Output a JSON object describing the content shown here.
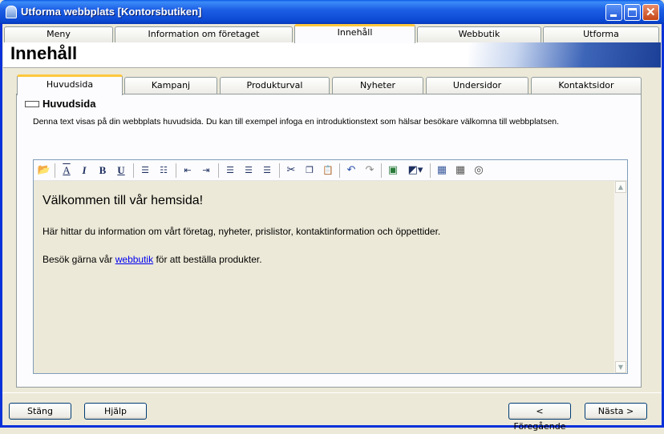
{
  "window": {
    "title": "Utforma webbplats [Kontorsbutiken]"
  },
  "top_tabs": [
    "Meny",
    "Information om företaget",
    "Innehåll",
    "Webbutik",
    "Utforma"
  ],
  "header": {
    "title": "Innehåll"
  },
  "inner_tabs": [
    "Huvudsida",
    "Kampanj",
    "Produkturval",
    "Nyheter",
    "Undersidor",
    "Kontaktsidor"
  ],
  "section": {
    "title": "Huvudsida",
    "description": "Denna text visas på din webbplats huvudsida. Du kan till exempel infoga en introduktionstext som hälsar besökare välkomna till webbplatsen."
  },
  "editor": {
    "heading": "Välkommen till vår hemsida!",
    "p1": "Här hittar du information om vårt företag, nyheter, prislistor, kontaktinformation och öppettider.",
    "p2_before": "Besök gärna vår",
    "p2_link": "webbutik",
    "p2_after": "för att beställa produkter."
  },
  "buttons": {
    "close": "Stäng",
    "help": "Hjälp",
    "prev": "< Föregående",
    "next": "Nästa >"
  },
  "toolbar_icons": [
    "open-folder",
    "font",
    "italic",
    "bold",
    "underline",
    "ordered-list",
    "unordered-list",
    "outdent",
    "indent",
    "align-left",
    "align-center",
    "align-right",
    "cut",
    "copy",
    "paste",
    "undo",
    "redo",
    "image",
    "fill-color",
    "table",
    "table-grid",
    "web"
  ]
}
